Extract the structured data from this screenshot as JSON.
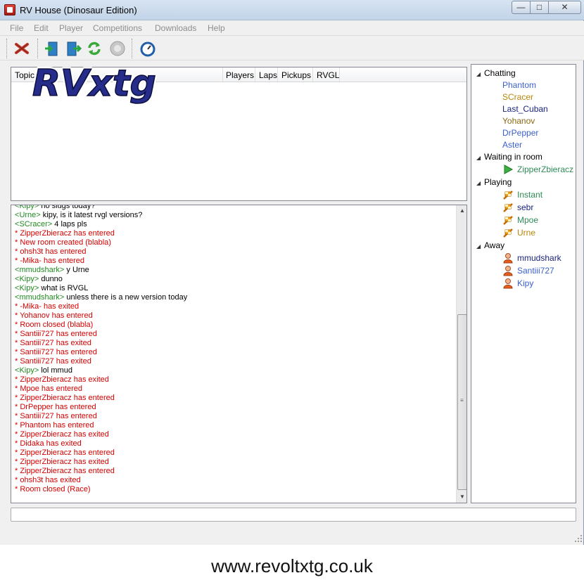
{
  "window": {
    "title": "RV House (Dinosaur Edition)"
  },
  "menu": [
    "File",
    "Edit",
    "Player",
    "Competitions",
    "Downloads",
    "Help"
  ],
  "rooms": {
    "columns": [
      "Topic",
      "Players",
      "Laps",
      "Pickups",
      "RVGL"
    ],
    "logo_text": "RVxtg"
  },
  "chat": [
    {
      "type": "chat",
      "nick": "Kipy",
      "text": "no slugs today?"
    },
    {
      "type": "chat",
      "nick": "Urne",
      "text": "kipy, is it latest rvgl versions?"
    },
    {
      "type": "chat",
      "nick": "SCracer",
      "text": "4 laps pls"
    },
    {
      "type": "sys",
      "text": "* ZipperZbieracz has entered"
    },
    {
      "type": "sys",
      "text": "* New room created (blabla)"
    },
    {
      "type": "sys",
      "text": "* ohsh3t has entered"
    },
    {
      "type": "sys",
      "text": "* -Mika- has entered"
    },
    {
      "type": "chat",
      "nick": "mmudshark",
      "text": "y Urne"
    },
    {
      "type": "chat",
      "nick": "Kipy",
      "text": "dunno"
    },
    {
      "type": "chat",
      "nick": "Kipy",
      "text": "what is RVGL"
    },
    {
      "type": "chat",
      "nick": "mmudshark",
      "text": "unless there is a new version today"
    },
    {
      "type": "sys",
      "text": "* -Mika- has exited"
    },
    {
      "type": "sys",
      "text": "* Yohanov has entered"
    },
    {
      "type": "sys",
      "text": "* Room closed (blabla)"
    },
    {
      "type": "sys",
      "text": "* Santiii727 has entered"
    },
    {
      "type": "sys",
      "text": "* Santiii727 has exited"
    },
    {
      "type": "sys",
      "text": "* Santiii727 has entered"
    },
    {
      "type": "sys",
      "text": "* Santiii727 has exited"
    },
    {
      "type": "chat",
      "nick": "Kipy",
      "text": "lol mmud"
    },
    {
      "type": "sys",
      "text": "* ZipperZbieracz has exited"
    },
    {
      "type": "sys",
      "text": "* Mpoe has entered"
    },
    {
      "type": "sys",
      "text": "* ZipperZbieracz has entered"
    },
    {
      "type": "sys",
      "text": "* DrPepper has entered"
    },
    {
      "type": "sys",
      "text": "* Santiii727 has entered"
    },
    {
      "type": "sys",
      "text": "* Phantom has entered"
    },
    {
      "type": "sys",
      "text": "* ZipperZbieracz has exited"
    },
    {
      "type": "sys",
      "text": "* Didaka has exited"
    },
    {
      "type": "sys",
      "text": "* ZipperZbieracz has entered"
    },
    {
      "type": "sys",
      "text": "* ZipperZbieracz has exited"
    },
    {
      "type": "sys",
      "text": "* ZipperZbieracz has entered"
    },
    {
      "type": "sys",
      "text": "* ohsh3t has exited"
    },
    {
      "type": "sys",
      "text": "* Room closed (Race)"
    }
  ],
  "users": {
    "chatting": {
      "label": "Chatting",
      "members": [
        {
          "name": "Phantom",
          "color": "#3a5fcd"
        },
        {
          "name": "SCracer",
          "color": "#b8860b"
        },
        {
          "name": "Last_Cuban",
          "color": "#1a237e"
        },
        {
          "name": "Yohanov",
          "color": "#8b6914"
        },
        {
          "name": "DrPepper",
          "color": "#3a5fcd"
        },
        {
          "name": "Aster",
          "color": "#3a5fcd"
        }
      ]
    },
    "waiting": {
      "label": "Waiting in room",
      "members": [
        {
          "name": "ZipperZbieracz",
          "color": "#2e8b57",
          "icon": "play-arrow-icon"
        }
      ]
    },
    "playing": {
      "label": "Playing",
      "members": [
        {
          "name": "Instant",
          "color": "#2e8b57",
          "icon": "race-flag-icon"
        },
        {
          "name": "sebr",
          "color": "#1a237e",
          "icon": "race-flag-icon"
        },
        {
          "name": "Mpoe",
          "color": "#2e8b57",
          "icon": "race-flag-icon"
        },
        {
          "name": "Urne",
          "color": "#b8860b",
          "icon": "race-flag-icon"
        }
      ]
    },
    "away": {
      "label": "Away",
      "members": [
        {
          "name": "mmudshark",
          "color": "#1a237e",
          "icon": "away-user-icon"
        },
        {
          "name": "Santiii727",
          "color": "#3a5fcd",
          "icon": "away-user-icon"
        },
        {
          "name": "Kipy",
          "color": "#3a5fcd",
          "icon": "away-user-icon"
        }
      ]
    }
  },
  "footer": {
    "website": "www.revoltxtg.co.uk"
  },
  "colors": {
    "system_message": "#d40000",
    "nick": "#208a20"
  }
}
